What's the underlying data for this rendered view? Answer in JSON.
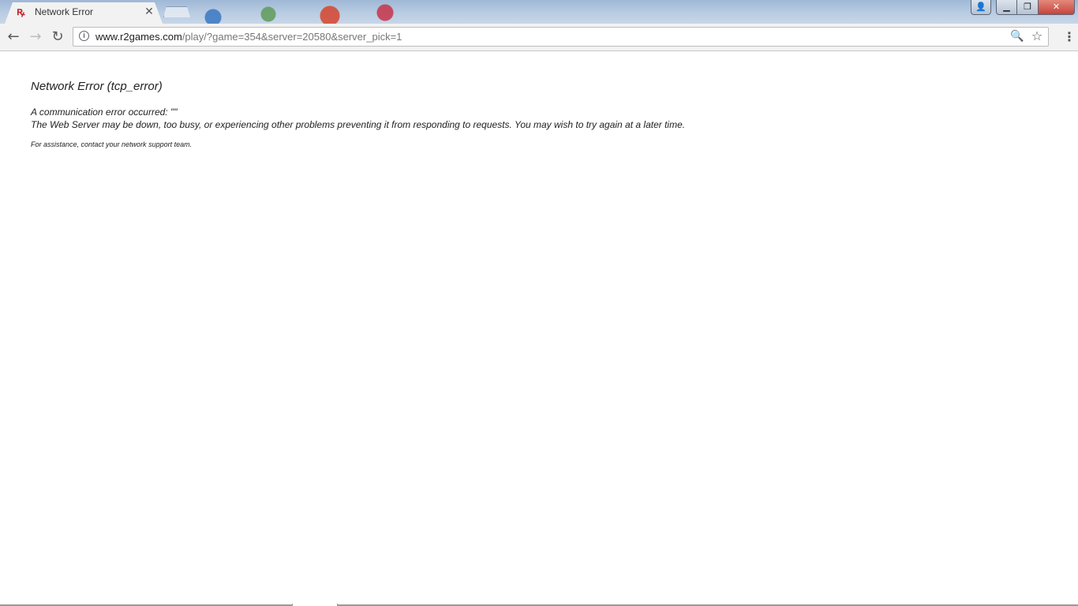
{
  "browser": {
    "tab": {
      "favicon": "r2-games-favicon",
      "title": "Network Error",
      "close_glyph": "✕"
    },
    "new_tab": "new-tab-button",
    "window_controls": {
      "user": "👤",
      "minimize": "▁",
      "maximize": "❐",
      "close": "✕"
    },
    "toolbar": {
      "back_glyph": "←",
      "forward_glyph": "→",
      "reload_glyph": "↻",
      "info_glyph": "i",
      "url_host": "www.r2games.com",
      "url_path": "/play/?game=354&server=20580&server_pick=1",
      "zoom_glyph": "🔍",
      "star_glyph": "☆",
      "menu_glyph": "⋮"
    }
  },
  "page": {
    "title": "Network Error (tcp_error)",
    "line1": "A communication error occurred: \"\"",
    "line2": "The Web Server may be down, too busy, or experiencing other problems preventing it from responding to requests. You may wish to try again at a later time.",
    "assistance": "For assistance, contact your network support team."
  },
  "colors": {
    "favicon": "#c0262d",
    "url_host": "#222222",
    "url_path": "#777777",
    "close_button": "#c7443a"
  }
}
